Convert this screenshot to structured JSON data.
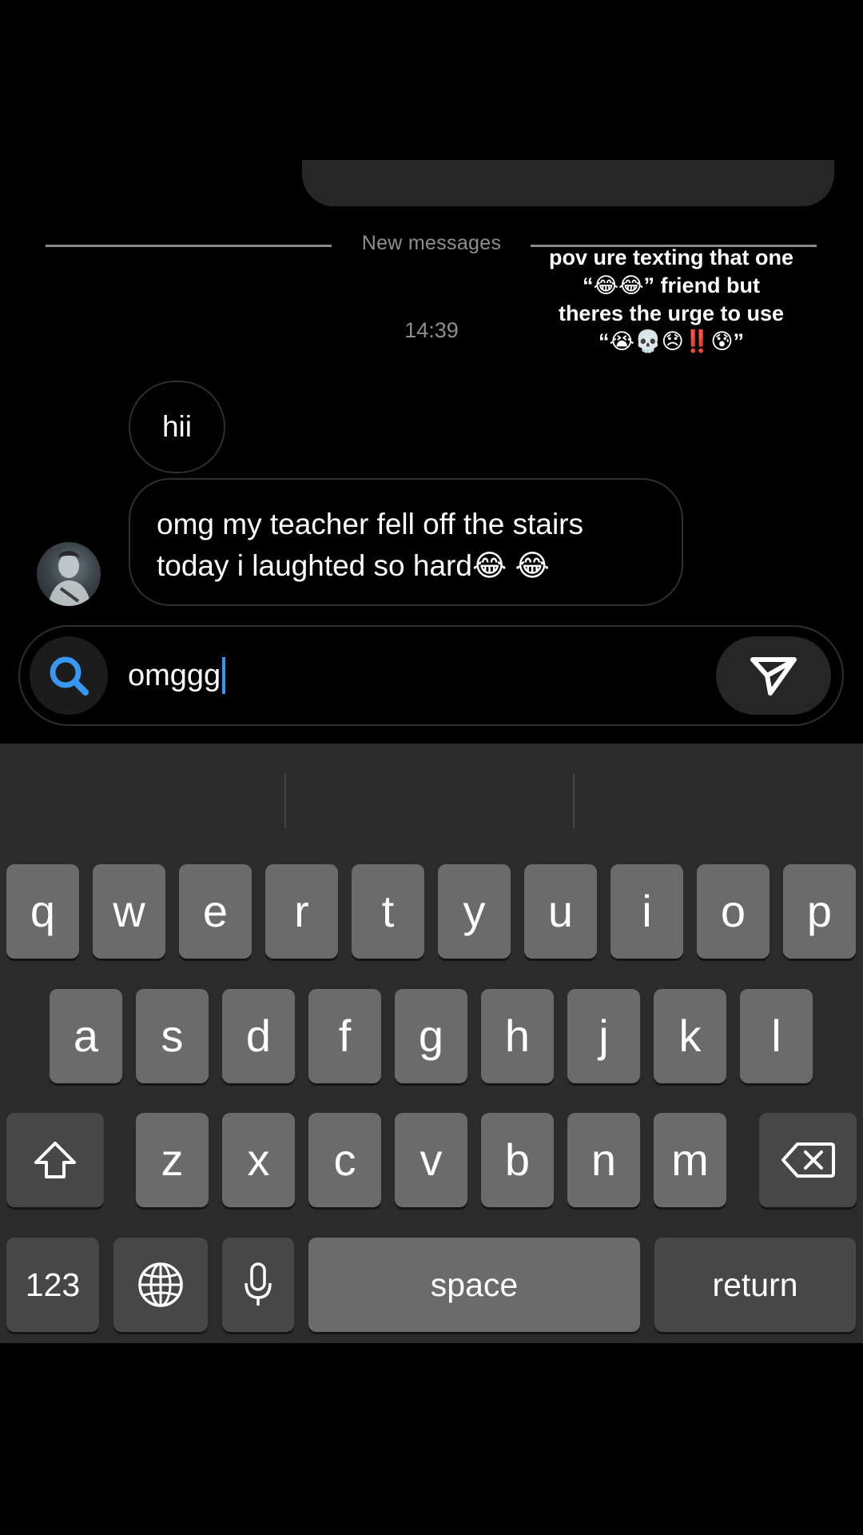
{
  "conversation": {
    "divider_label": "New messages",
    "timestamp": "14:39",
    "messages": [
      {
        "sender": "them",
        "text": "hii"
      },
      {
        "sender": "them",
        "lines": [
          "omg my teacher fell off the stairs",
          "today i laughted so hard😂 😂"
        ]
      }
    ]
  },
  "overlay_caption": {
    "lines": [
      "pov ure texting that one",
      "“😂😂” friend but",
      "theres the urge to use",
      "“😭💀😞‼️😰”"
    ]
  },
  "composer": {
    "value": "omggg",
    "search_icon": "search-icon",
    "send_icon": "send-icon"
  },
  "keyboard": {
    "row1": [
      "q",
      "w",
      "e",
      "r",
      "t",
      "y",
      "u",
      "i",
      "o",
      "p"
    ],
    "row2": [
      "a",
      "s",
      "d",
      "f",
      "g",
      "h",
      "j",
      "k",
      "l"
    ],
    "row3": [
      "z",
      "x",
      "c",
      "v",
      "b",
      "n",
      "m"
    ],
    "shift_icon": "shift-icon",
    "backspace_icon": "backspace-icon",
    "numbers_label": "123",
    "globe_icon": "globe-icon",
    "mic_icon": "microphone-icon",
    "space_label": "space",
    "return_label": "return"
  },
  "colors": {
    "background": "#000000",
    "bubble_border": "#2f2f2f",
    "keyboard_bg": "#2b2b2b",
    "key_light": "#6b6b6b",
    "key_dark": "#474747",
    "caret": "#3897f0",
    "search_icon": "#3897f0"
  }
}
